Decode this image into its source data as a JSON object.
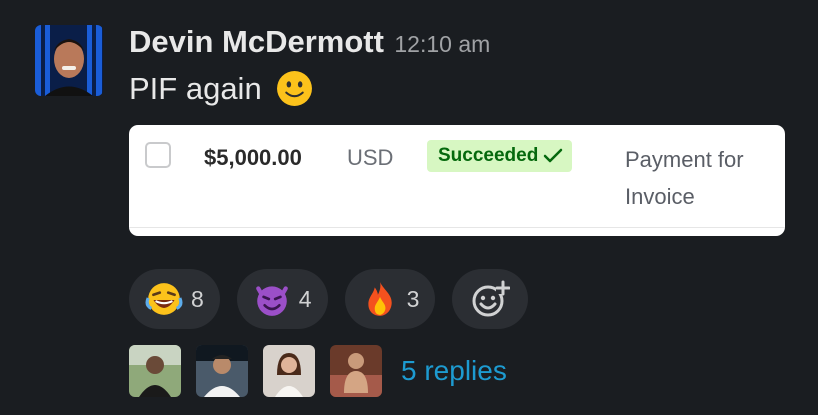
{
  "message": {
    "author": "Devin McDermott",
    "timestamp": "12:10 am",
    "text": "PIF again",
    "text_emoji": "slightly-smiling-face"
  },
  "payment_card": {
    "amount": "$5,000.00",
    "currency": "USD",
    "status": "Succeeded",
    "description": "Payment for Invoice",
    "checked": false,
    "status_color": "#05690d",
    "status_bg": "#d7f7c2"
  },
  "reactions": [
    {
      "emoji": "laughing-crying-face",
      "count": "8"
    },
    {
      "emoji": "smiling-imp",
      "count": "4"
    },
    {
      "emoji": "fire",
      "count": "3"
    }
  ],
  "add_reaction_icon": "add-reaction-icon",
  "thread": {
    "replier_avatars": [
      "replier-1",
      "replier-2",
      "replier-3",
      "replier-4"
    ],
    "replies_label": "5 replies"
  },
  "colors": {
    "background": "#1a1d21",
    "link": "#1d9bd1",
    "pill": "#2b2e33"
  }
}
